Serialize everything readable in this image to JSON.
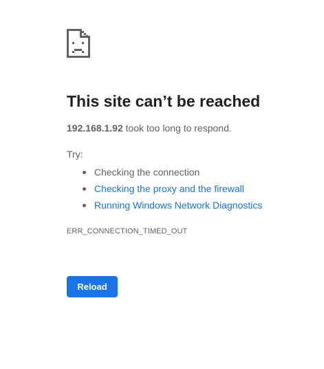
{
  "error_page": {
    "icon": "sad-page-icon",
    "title": "This site can’t be reached",
    "host": "192.168.1.92",
    "summary_suffix": " took too long to respond.",
    "try_label": "Try:",
    "suggestions": [
      {
        "label": "Checking the connection",
        "type": "text"
      },
      {
        "label": "Checking the proxy and the firewall",
        "type": "link"
      },
      {
        "label": "Running Windows Network Diagnostics",
        "type": "link"
      }
    ],
    "error_code": "ERR_CONNECTION_TIMED_OUT",
    "reload_label": "Reload"
  },
  "colors": {
    "title": "#202124",
    "body_text": "#5f6368",
    "link": "#1a73e8",
    "button_bg": "#1a73e8",
    "button_text": "#ffffff"
  }
}
